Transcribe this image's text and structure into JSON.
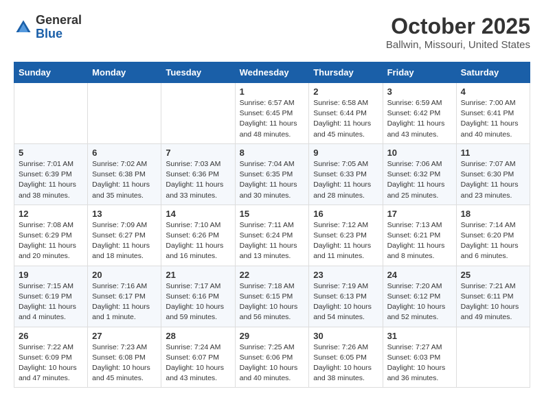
{
  "header": {
    "logo_line1": "General",
    "logo_line2": "Blue",
    "title": "October 2025",
    "subtitle": "Ballwin, Missouri, United States"
  },
  "weekdays": [
    "Sunday",
    "Monday",
    "Tuesday",
    "Wednesday",
    "Thursday",
    "Friday",
    "Saturday"
  ],
  "rows": [
    [
      {
        "day": "",
        "info": ""
      },
      {
        "day": "",
        "info": ""
      },
      {
        "day": "",
        "info": ""
      },
      {
        "day": "1",
        "info": "Sunrise: 6:57 AM\nSunset: 6:45 PM\nDaylight: 11 hours\nand 48 minutes."
      },
      {
        "day": "2",
        "info": "Sunrise: 6:58 AM\nSunset: 6:44 PM\nDaylight: 11 hours\nand 45 minutes."
      },
      {
        "day": "3",
        "info": "Sunrise: 6:59 AM\nSunset: 6:42 PM\nDaylight: 11 hours\nand 43 minutes."
      },
      {
        "day": "4",
        "info": "Sunrise: 7:00 AM\nSunset: 6:41 PM\nDaylight: 11 hours\nand 40 minutes."
      }
    ],
    [
      {
        "day": "5",
        "info": "Sunrise: 7:01 AM\nSunset: 6:39 PM\nDaylight: 11 hours\nand 38 minutes."
      },
      {
        "day": "6",
        "info": "Sunrise: 7:02 AM\nSunset: 6:38 PM\nDaylight: 11 hours\nand 35 minutes."
      },
      {
        "day": "7",
        "info": "Sunrise: 7:03 AM\nSunset: 6:36 PM\nDaylight: 11 hours\nand 33 minutes."
      },
      {
        "day": "8",
        "info": "Sunrise: 7:04 AM\nSunset: 6:35 PM\nDaylight: 11 hours\nand 30 minutes."
      },
      {
        "day": "9",
        "info": "Sunrise: 7:05 AM\nSunset: 6:33 PM\nDaylight: 11 hours\nand 28 minutes."
      },
      {
        "day": "10",
        "info": "Sunrise: 7:06 AM\nSunset: 6:32 PM\nDaylight: 11 hours\nand 25 minutes."
      },
      {
        "day": "11",
        "info": "Sunrise: 7:07 AM\nSunset: 6:30 PM\nDaylight: 11 hours\nand 23 minutes."
      }
    ],
    [
      {
        "day": "12",
        "info": "Sunrise: 7:08 AM\nSunset: 6:29 PM\nDaylight: 11 hours\nand 20 minutes."
      },
      {
        "day": "13",
        "info": "Sunrise: 7:09 AM\nSunset: 6:27 PM\nDaylight: 11 hours\nand 18 minutes."
      },
      {
        "day": "14",
        "info": "Sunrise: 7:10 AM\nSunset: 6:26 PM\nDaylight: 11 hours\nand 16 minutes."
      },
      {
        "day": "15",
        "info": "Sunrise: 7:11 AM\nSunset: 6:24 PM\nDaylight: 11 hours\nand 13 minutes."
      },
      {
        "day": "16",
        "info": "Sunrise: 7:12 AM\nSunset: 6:23 PM\nDaylight: 11 hours\nand 11 minutes."
      },
      {
        "day": "17",
        "info": "Sunrise: 7:13 AM\nSunset: 6:21 PM\nDaylight: 11 hours\nand 8 minutes."
      },
      {
        "day": "18",
        "info": "Sunrise: 7:14 AM\nSunset: 6:20 PM\nDaylight: 11 hours\nand 6 minutes."
      }
    ],
    [
      {
        "day": "19",
        "info": "Sunrise: 7:15 AM\nSunset: 6:19 PM\nDaylight: 11 hours\nand 4 minutes."
      },
      {
        "day": "20",
        "info": "Sunrise: 7:16 AM\nSunset: 6:17 PM\nDaylight: 11 hours\nand 1 minute."
      },
      {
        "day": "21",
        "info": "Sunrise: 7:17 AM\nSunset: 6:16 PM\nDaylight: 10 hours\nand 59 minutes."
      },
      {
        "day": "22",
        "info": "Sunrise: 7:18 AM\nSunset: 6:15 PM\nDaylight: 10 hours\nand 56 minutes."
      },
      {
        "day": "23",
        "info": "Sunrise: 7:19 AM\nSunset: 6:13 PM\nDaylight: 10 hours\nand 54 minutes."
      },
      {
        "day": "24",
        "info": "Sunrise: 7:20 AM\nSunset: 6:12 PM\nDaylight: 10 hours\nand 52 minutes."
      },
      {
        "day": "25",
        "info": "Sunrise: 7:21 AM\nSunset: 6:11 PM\nDaylight: 10 hours\nand 49 minutes."
      }
    ],
    [
      {
        "day": "26",
        "info": "Sunrise: 7:22 AM\nSunset: 6:09 PM\nDaylight: 10 hours\nand 47 minutes."
      },
      {
        "day": "27",
        "info": "Sunrise: 7:23 AM\nSunset: 6:08 PM\nDaylight: 10 hours\nand 45 minutes."
      },
      {
        "day": "28",
        "info": "Sunrise: 7:24 AM\nSunset: 6:07 PM\nDaylight: 10 hours\nand 43 minutes."
      },
      {
        "day": "29",
        "info": "Sunrise: 7:25 AM\nSunset: 6:06 PM\nDaylight: 10 hours\nand 40 minutes."
      },
      {
        "day": "30",
        "info": "Sunrise: 7:26 AM\nSunset: 6:05 PM\nDaylight: 10 hours\nand 38 minutes."
      },
      {
        "day": "31",
        "info": "Sunrise: 7:27 AM\nSunset: 6:03 PM\nDaylight: 10 hours\nand 36 minutes."
      },
      {
        "day": "",
        "info": ""
      }
    ]
  ]
}
